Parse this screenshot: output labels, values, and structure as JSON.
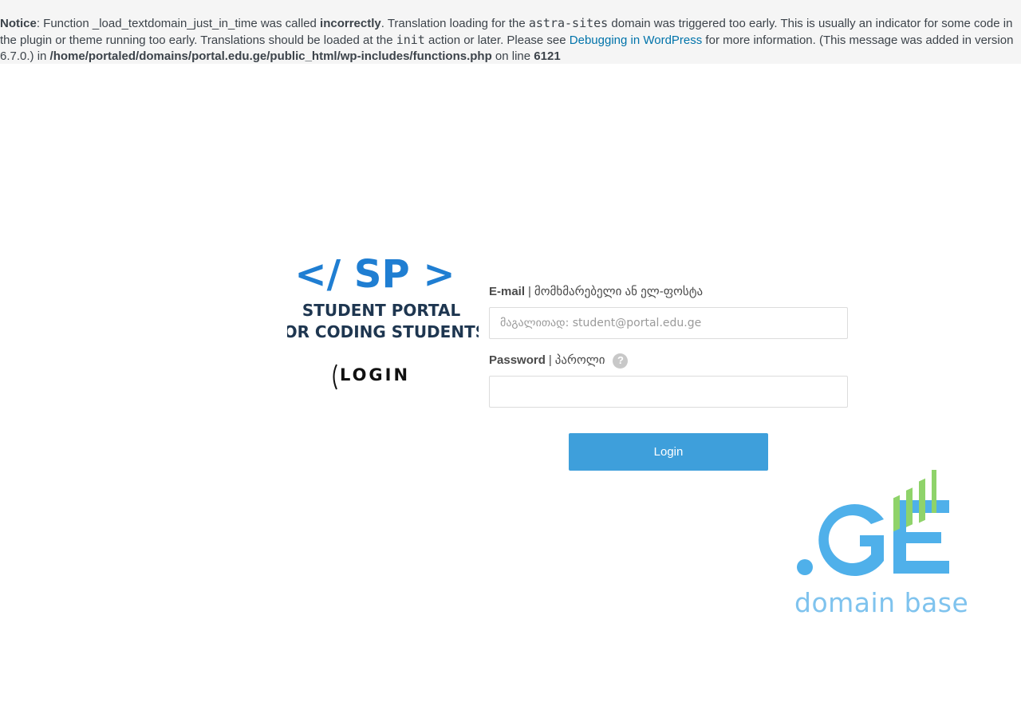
{
  "notice": {
    "label": "Notice",
    "t1": ": Function _load_textdomain_just_in_time was called ",
    "strong1": "incorrectly",
    "t2": ". Translation loading for the ",
    "code1": "astra-sites",
    "t3": " domain was triggered too early. This is usually an indicator for some code in the plugin or theme running too early. Translations should be loaded at the ",
    "code2": "init",
    "t4": " action or later. Please see ",
    "link": "Debugging in WordPress",
    "t5": " for more information. (This message was added in version 6.7.0.) in ",
    "path": "/home/portaled/domains/portal.edu.ge/public_html/wp-includes/functions.php",
    "t6": " on line ",
    "line": "6121"
  },
  "logo": {
    "mark": "</ SP >",
    "line1": "STUDENT PORTAL",
    "line2": "FOR  CODING  STUDENTS",
    "login": "LOGIN"
  },
  "form": {
    "email_label": "E-mail",
    "email_sep": "|",
    "email_label_geo": "მომხმარებელი ან ელ-ფოსტა",
    "email_placeholder": "მაგალითად: student@portal.edu.ge",
    "email_value": "",
    "password_label": "Password",
    "password_sep": "|",
    "password_label_geo": "პაროლი",
    "help": "?",
    "password_value": "",
    "login_button": "Login"
  },
  "brand": {
    "mark": ".GE",
    "tagline": "domain base"
  },
  "colors": {
    "button": "#3e9fdb",
    "link": "#0073aa",
    "logo_blue": "#1f7ed2",
    "brand_blue": "#4fb0ea",
    "brand_green": "#8fd36a"
  }
}
